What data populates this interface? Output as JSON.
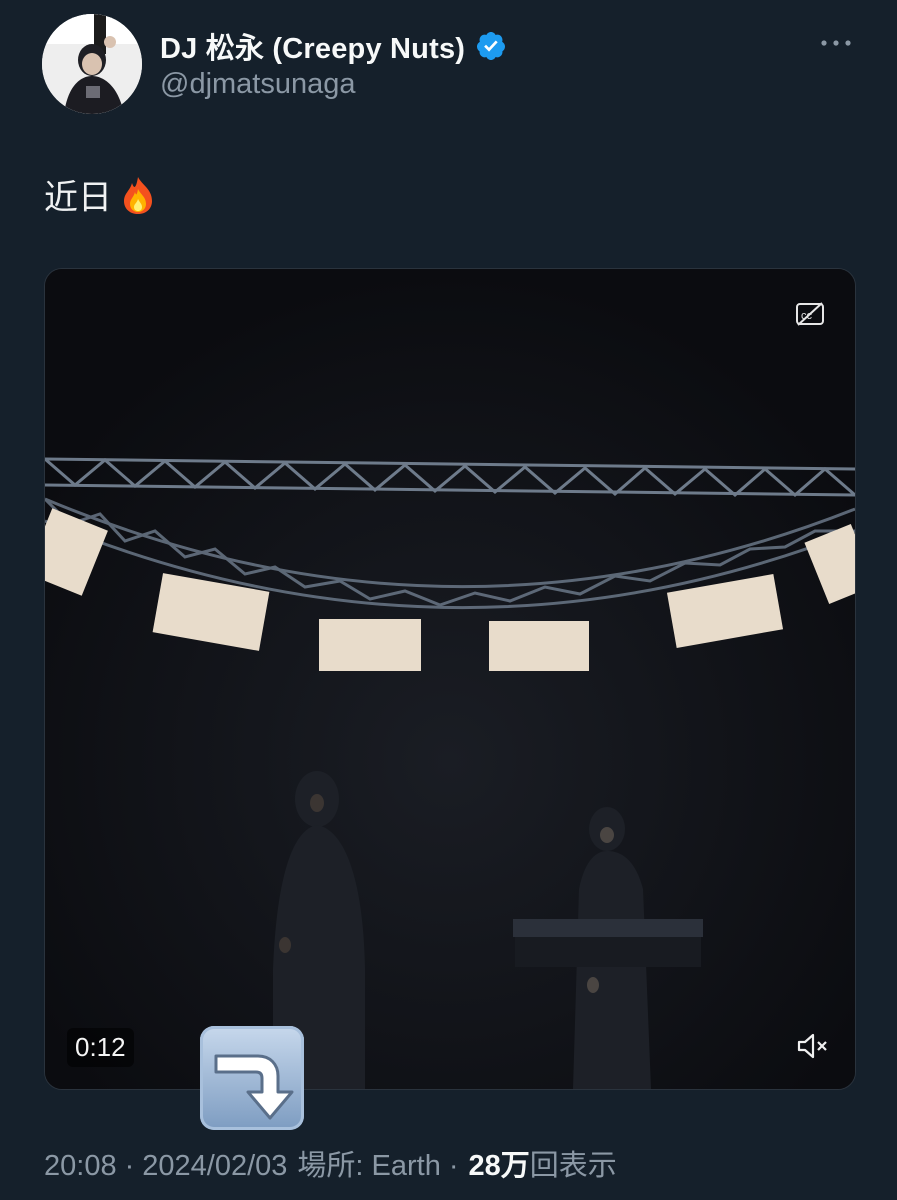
{
  "author": {
    "display_name": "DJ 松永 (Creepy Nuts)",
    "handle": "@djmatsunaga",
    "verified": true,
    "avatar_icon": "user-avatar"
  },
  "tweet": {
    "text": "近日",
    "emoji": "fire-emoji"
  },
  "video": {
    "elapsed": "0:12",
    "captions_icon": "closed-captions-off-icon",
    "mute_icon": "speaker-muted-icon"
  },
  "overlay_emoji": "arrow-curving-down-emoji",
  "meta": {
    "time": "20:08",
    "date": "2024/02/03",
    "location": "場所: Earth",
    "views_count": "28万",
    "views_label": "回表示",
    "separator": "·"
  },
  "colors": {
    "background": "#15202b",
    "secondary_text": "#8b98a5",
    "verified_blue": "#1d9bf0"
  }
}
